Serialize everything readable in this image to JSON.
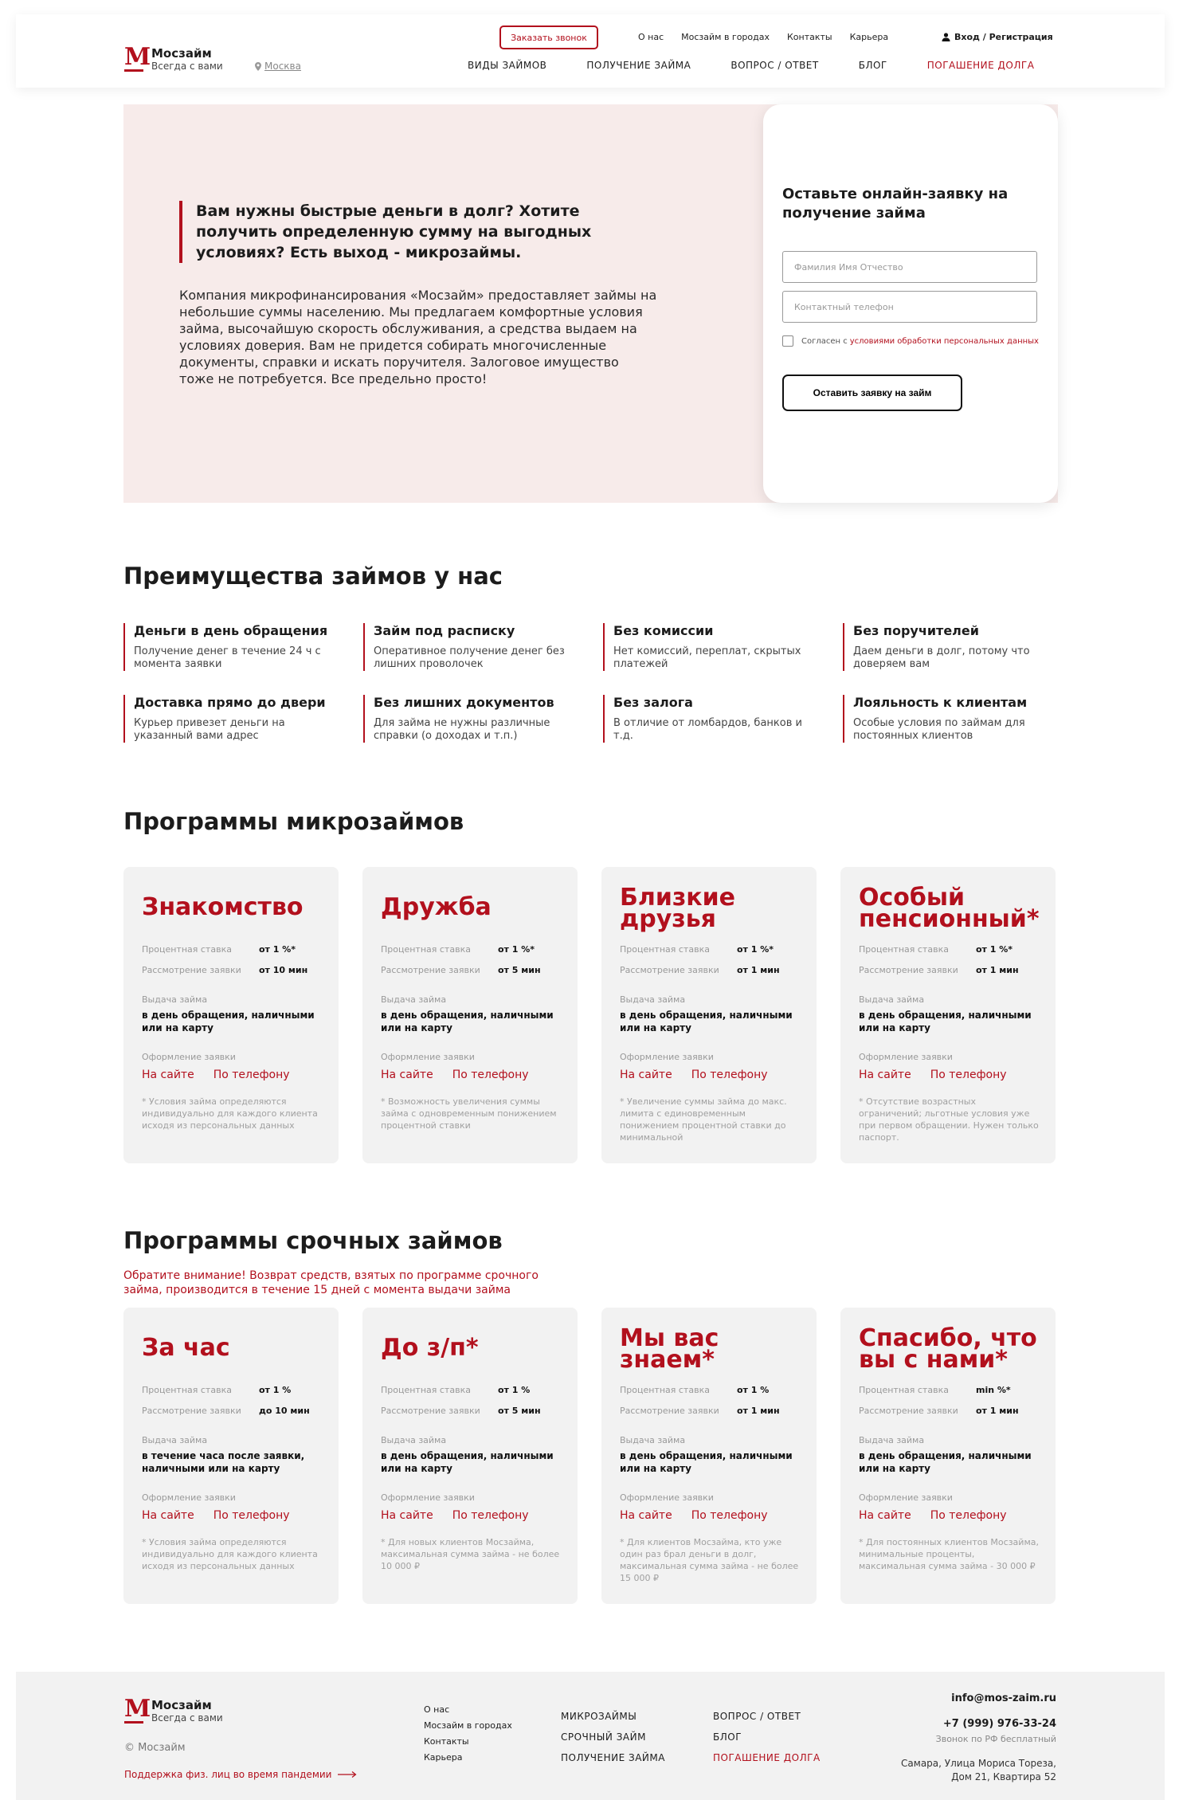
{
  "brand": {
    "logo_letter": "М",
    "name": "Мосзайм",
    "tagline": "Всегда с вами"
  },
  "header": {
    "city": "Москва",
    "call_button": "Заказать звонок",
    "top_links": [
      "О нас",
      "Мосзайм в городах",
      "Контакты",
      "Карьера"
    ],
    "login": "Вход / Регистрация",
    "nav": [
      "ВИДЫ ЗАЙМОВ",
      "ПОЛУЧЕНИЕ ЗАЙМА",
      "ВОПРОС / ОТВЕТ",
      "БЛОГ",
      "ПОГАШЕНИЕ ДОЛГА"
    ]
  },
  "hero": {
    "heading": "Вам нужны быстрые деньги в долг? Хотите получить определенную сумму на выгодных условиях? Есть выход - микрозаймы.",
    "text": "Компания микрофинансирования «Мосзайм» предоставляет займы на небольшие суммы населению. Мы предлагаем комфортные условия займа, высочайшую скорость обслуживания, а средства выдаем на условиях доверия. Вам не придется собирать многочисленные документы, справки и искать поручителя. Залоговое имущество тоже не потребуется. Все предельно просто!"
  },
  "form": {
    "title": "Оставьте онлайн-заявку на получение займа",
    "name_placeholder": "Фамилия Имя Отчество",
    "phone_placeholder": "Контактный телефон",
    "agree_text": "Согласен с",
    "agree_link": "условиями обработки персональных данных",
    "submit": "Оставить заявку на займ"
  },
  "advantages": {
    "title": "Преимущества займов у нас",
    "items": [
      {
        "title": "Деньги в день обращения",
        "desc": "Получение денег в течение 24 ч с момента заявки"
      },
      {
        "title": "Займ под расписку",
        "desc": "Оперативное получение денег без лишних проволочек"
      },
      {
        "title": "Без комиссии",
        "desc": "Нет комиссий, переплат, скрытых платежей"
      },
      {
        "title": "Без поручителей",
        "desc": "Даем деньги в долг, потому что доверяем вам"
      },
      {
        "title": "Доставка прямо до двери",
        "desc": "Курьер привезет деньги на указанный вами адрес"
      },
      {
        "title": "Без лишних документов",
        "desc": "Для займа не нужны различные справки (о доходах и т.п.)"
      },
      {
        "title": "Без залога",
        "desc": "В отличие от ломбардов, банков и т.д."
      },
      {
        "title": "Лояльность к клиентам",
        "desc": "Особые условия по займам для постоянных клиентов"
      }
    ]
  },
  "labels": {
    "rate": "Процентная ставка",
    "review": "Рассмотрение заявки",
    "issue": "Выдача займа",
    "apply": "Оформление заявки",
    "on_site": "На сайте",
    "by_phone": "По телефону"
  },
  "micro": {
    "title": "Программы микрозаймов",
    "cards": [
      {
        "name": "Знакомство",
        "rate": "от 1 %*",
        "review": "от 10 мин",
        "issue": "в день обращения, наличными или на карту",
        "note": "* Условия займа определяются индивидуально для каждого клиента исходя из персональных данных"
      },
      {
        "name": "Дружба",
        "rate": "от 1 %*",
        "review": "от 5 мин",
        "issue": "в день обращения, наличными или на карту",
        "note": "* Возможность увеличения суммы займа с одновременным понижением процентной ставки"
      },
      {
        "name": "Близкие друзья",
        "rate": "от 1 %*",
        "review": "от 1 мин",
        "issue": "в день обращения, наличными или на карту",
        "note": "* Увеличение суммы займа до макс. лимита с единовременным понижением процентной ставки до минимальной"
      },
      {
        "name": "Особый пенсионный*",
        "rate": "от 1 %*",
        "review": "от 1 мин",
        "issue": "в день обращения, наличными или на карту",
        "note": "* Отсутствие возрастных ограничений; льготные условия уже при первом обращении. Нужен только паспорт."
      }
    ]
  },
  "urgent": {
    "title": "Программы срочных займов",
    "notice": "Обратите внимание! Возврат средств, взятых по программе срочного займа, производится в течение 15 дней с момента выдачи займа",
    "cards": [
      {
        "name": "За час",
        "rate": "от 1 %",
        "review": "до 10 мин",
        "issue": "в течение часа после заявки, наличными или на карту",
        "note": "* Условия займа определяются индивидуально для каждого клиента исходя из персональных данных"
      },
      {
        "name": "До з/п*",
        "rate": "от 1 %",
        "review": "от 5 мин",
        "issue": "в день обращения, наличными или на карту",
        "note": "* Для новых клиентов Мосзайма, максимальная сумма займа - не более 10 000 ₽"
      },
      {
        "name": "Мы вас знаем*",
        "rate": "от 1 %",
        "review": "от 1 мин",
        "issue": "в день обращения, наличными или на карту",
        "note": "* Для клиентов Мосзайма, кто уже один раз брал деньги в долг, максимальная сумма займа - не более 15 000 ₽"
      },
      {
        "name": "Спасибо, что вы с нами*",
        "rate": "min %*",
        "review": "от 1 мин",
        "issue": "в день обращения, наличными или на карту",
        "note": "* Для постоянных клиентов Мосзайма, минимальные проценты, максимальная сумма займа - 30 000 ₽"
      }
    ]
  },
  "footer": {
    "copyright": "© Мосзайм",
    "support": "Поддержка физ. лиц во время пандемии",
    "col1": [
      "О нас",
      "Мосзайм в городах",
      "Контакты",
      "Карьера"
    ],
    "col2": [
      "МИКРОЗАЙМЫ",
      "СРОЧНЫЙ ЗАЙМ",
      "ПОЛУЧЕНИЕ ЗАЙМА"
    ],
    "col3": [
      "ВОПРОС / ОТВЕТ",
      "БЛОГ",
      "ПОГАШЕНИЕ ДОЛГА"
    ],
    "email": "info@mos-zaim.ru",
    "phone": "+7 (999) 976-33-24",
    "phone_note": "Звонок по РФ бесплатный",
    "address_line1": "Самара, Улица Мориса Тореза,",
    "address_line2": "Дом 21, Квартира 52"
  }
}
